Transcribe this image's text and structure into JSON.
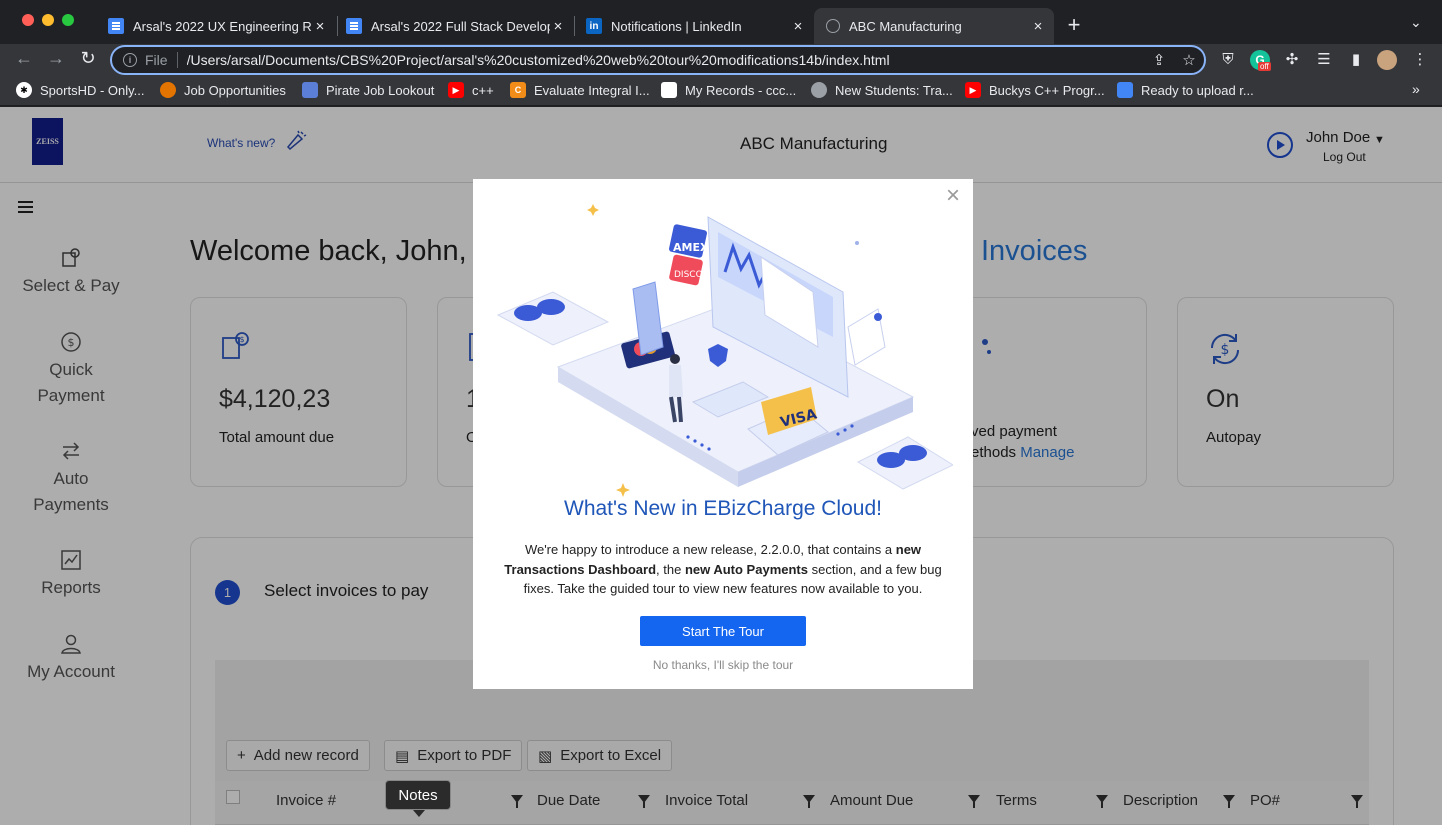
{
  "browser": {
    "tabs": [
      {
        "title": "Arsal's 2022 UX Engineering R",
        "favicon": "google-docs-icon",
        "active": false
      },
      {
        "title": "Arsal's 2022 Full Stack Develop",
        "favicon": "google-docs-icon",
        "active": false
      },
      {
        "title": "Notifications | LinkedIn",
        "favicon": "linkedin-icon",
        "active": false
      },
      {
        "title": "ABC Manufacturing",
        "favicon": "globe-icon",
        "active": true
      }
    ],
    "close_glyph": "×",
    "new_tab_glyph": "+",
    "address": {
      "scheme": "File",
      "url": "/Users/arsal/Documents/CBS%20Project/arsal's%20customized%20web%20tour%20modifications14b/index.html"
    },
    "grammarly_badge": "off",
    "bookmarks": [
      {
        "label": "SportsHD - Only...",
        "icon": "sports-icon",
        "color": "#e8eaed"
      },
      {
        "label": "Job Opportunities",
        "icon": "job-icon",
        "color": "#e37400"
      },
      {
        "label": "Pirate Job Lookout",
        "icon": "pirate-icon",
        "color": "#5b7fd6"
      },
      {
        "label": "c++",
        "icon": "youtube-icon",
        "color": "#ff0000"
      },
      {
        "label": "Evaluate Integral I...",
        "icon": "calc-icon",
        "color": "#f28c18"
      },
      {
        "label": "My Records - ccc...",
        "icon": "records-icon",
        "color": "#ffffff"
      },
      {
        "label": "New Students: Tra...",
        "icon": "school-icon",
        "color": "#9aa0a6"
      },
      {
        "label": "Buckys C++ Progr...",
        "icon": "youtube-icon",
        "color": "#ff0000"
      },
      {
        "label": "Ready to upload r...",
        "icon": "google-docs-icon",
        "color": "#4285f4"
      }
    ],
    "bookmarks_more": "»"
  },
  "header": {
    "logo_text": "ZEISS",
    "whats_new": "What's new?",
    "app_title": "ABC Manufacturing",
    "user_name": "John Doe",
    "logout": "Log Out"
  },
  "sidebar": {
    "items": [
      {
        "label": "Select & Pay",
        "icon": "invoice-icon",
        "active": true
      },
      {
        "label": "Quick Payment",
        "icon": "dollar-circle-icon"
      },
      {
        "label": "Auto Payments",
        "icon": "auto-pay-icon"
      },
      {
        "label": "Reports",
        "icon": "chart-icon"
      },
      {
        "label": "My Account",
        "icon": "user-icon"
      }
    ]
  },
  "main": {
    "welcome": "Welcome back, John, l",
    "invoices_link": "Invoices",
    "cards": [
      {
        "amount": "$4,120,23",
        "label": "Total amount due",
        "icon": "invoice-dollar-icon"
      },
      {
        "amount": "1",
        "label": "O",
        "icon": "document-icon"
      },
      {
        "amount": "",
        "label": "ved payment",
        "label2": "ethods",
        "link": "Manage",
        "icon": "cards-icon"
      },
      {
        "amount": "On",
        "label": "Autopay",
        "icon": "autopay-icon"
      }
    ],
    "step": {
      "number": "1",
      "label": "Select invoices to pay"
    },
    "toolbar": {
      "add_record": "Add new record",
      "export_pdf": "Export to PDF",
      "export_excel": "Export to Excel"
    },
    "columns": [
      "Invoice #",
      "Due Date",
      "Invoice Total",
      "Amount Due",
      "Terms",
      "Description",
      "PO#"
    ],
    "tooltip": "Notes"
  },
  "modal": {
    "title": "What's New in EBizCharge Cloud!",
    "body_1": "We're happy to introduce a new release, 2.2.0.0, that contains a ",
    "body_bold_1": "new Transactions Dashboard",
    "body_2": ", the ",
    "body_bold_2": "new Auto Payments",
    "body_3": " section, and a few bug fixes. Take the guided tour to view new features now available to you.",
    "cta": "Start The Tour",
    "skip": "No thanks, I'll skip the tour",
    "illustration_labels": {
      "amex": "AMEX",
      "discover": "DISCO",
      "visa": "VISA"
    },
    "close_glyph": "×"
  },
  "colors": {
    "accent": "#1466f0",
    "modal_title": "#1f56b8",
    "sidebar": "#2f3b47",
    "sidebar_active": "#4a5663",
    "link": "#2a78d6"
  }
}
